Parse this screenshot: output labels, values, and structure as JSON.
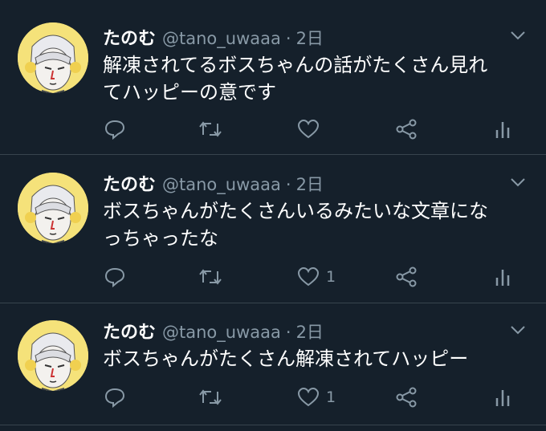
{
  "colors": {
    "background": "#15202b",
    "divider": "#38444d",
    "secondary": "#8899a6",
    "text": "#ffffff"
  },
  "tweets": [
    {
      "name": "たのむ",
      "handle": "@tano_uwaaa",
      "separator": "·",
      "time": "2日",
      "lines": [
        "解凍されてるボスちゃんの話がたくさん見れ",
        "てハッピーの意です"
      ],
      "like_count": ""
    },
    {
      "name": "たのむ",
      "handle": "@tano_uwaaa",
      "separator": "·",
      "time": "2日",
      "lines": [
        "ボスちゃんがたくさんいるみたいな文章にな",
        "っちゃったな"
      ],
      "like_count": "1"
    },
    {
      "name": "たのむ",
      "handle": "@tano_uwaaa",
      "separator": "·",
      "time": "2日",
      "lines": [
        "ボスちゃんがたくさん解凍されてハッピー"
      ],
      "like_count": "1"
    }
  ],
  "icons": [
    "reply-icon",
    "retweet-icon",
    "like-icon",
    "share-icon",
    "analytics-icon",
    "chevron-down-icon"
  ]
}
